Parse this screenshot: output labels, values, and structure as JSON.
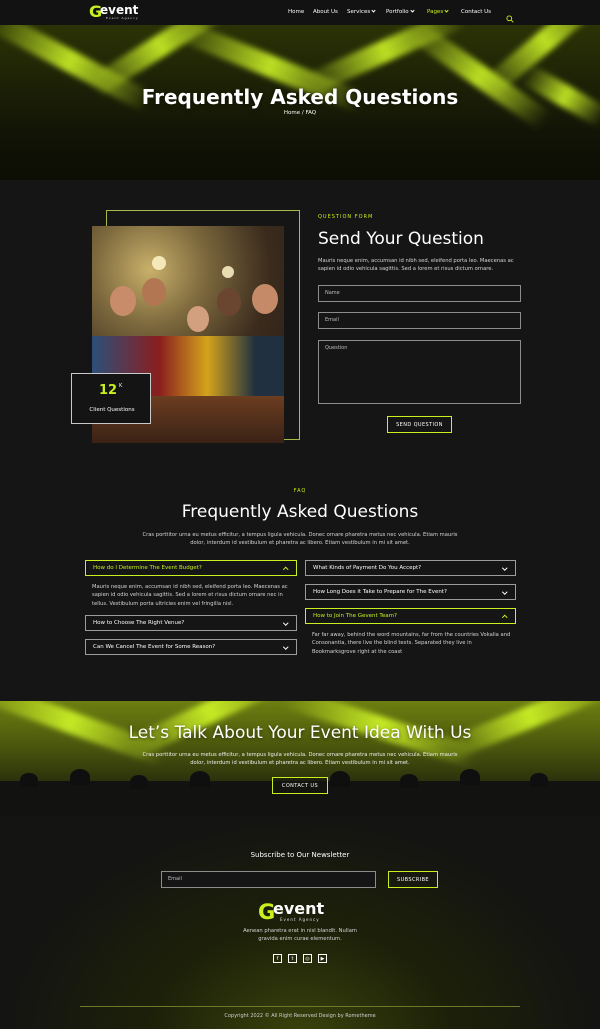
{
  "header": {
    "logo_g": "G",
    "logo_word": "event",
    "logo_tag": "Event Agency",
    "nav": [
      "Home",
      "About Us",
      "Services",
      "Portfolio",
      "Pages",
      "Contact Us"
    ]
  },
  "hero": {
    "title": "Frequently Asked Questions",
    "breadcrumb_home": "Home",
    "breadcrumb_sep": " / ",
    "breadcrumb_current": "FAQ"
  },
  "question_form": {
    "eyebrow": "QUESTION FORM",
    "title": "Send Your Question",
    "description": "Mauris neque enim, accumsan id nibh sed, eleifend porta leo. Maecenas ac sapien id odio vehicula sagittis. Sed a lorem et risus dictum ornare.",
    "name_placeholder": "Name",
    "email_placeholder": "Email",
    "question_placeholder": "Question",
    "submit_label": "SEND QUESTION",
    "stat_value": "12",
    "stat_suffix": "K",
    "stat_label": "Client Questions"
  },
  "faq": {
    "eyebrow": "FAQ",
    "title": "Frequently Asked Questions",
    "intro": "Cras porttitor urna eu metus efficitur, a tempus ligula vehicula. Donec ornare pharetra metus nec vehicula. Etiam mauris dolor, interdum id vestibulum et pharetra ac libero. Etiam vestibulum in mi sit amet.",
    "left": [
      {
        "q": "How do I Determine The Event Budget?",
        "open": true,
        "a": "Mauris neque enim, accumsan id nibh sed, eleifend porta leo. Maecenas ac sapien id odio vehicula sagittis. Sed a lorem et risus dictum ornare nec in tellus. Vestibulum porta ultricies enim vel fringilla nisl."
      },
      {
        "q": "How to Choose The Right Venue?",
        "open": false
      },
      {
        "q": "Can We Cancel The Event for Some Reason?",
        "open": false
      }
    ],
    "right": [
      {
        "q": "What Kinds of Payment Do You Accept?",
        "open": false
      },
      {
        "q": "How Long Does it Take to Prepare for The Event?",
        "open": false
      },
      {
        "q": "How to Join The Gevent Team?",
        "open": true,
        "a": "Far far away, behind the word mountains, far from the countries Vokalia and Consonantia, there live the blind texts. Separated they live in Bookmarksgrove right at the coast"
      }
    ]
  },
  "cta": {
    "title": "Let’s Talk About Your Event Idea With Us",
    "text": "Cras porttitor urna eu metus efficitur, a tempus ligula vehicula. Donec ornare pharetra metus nec vehicula. Etiam mauris dolor, interdum id vestibulum et pharetra ac libero. Etiam vestibulum in mi sit amet.",
    "button": "CONTACT US"
  },
  "footer": {
    "newsletter_title": "Subscribe to Our Newsletter",
    "email_placeholder": "Email",
    "subscribe_label": "SUBSCRIBE",
    "about": "Aenean pharetra erat in nisl blandit. Nullam gravida enim curae elementum.",
    "social": [
      "facebook-icon",
      "twitter-icon",
      "instagram-icon",
      "youtube-icon"
    ],
    "copyright": "Copyright 2022 © All Right Reserved Design by Rometheme"
  },
  "colors": {
    "accent": "#c8f01e",
    "background": "#151515"
  }
}
